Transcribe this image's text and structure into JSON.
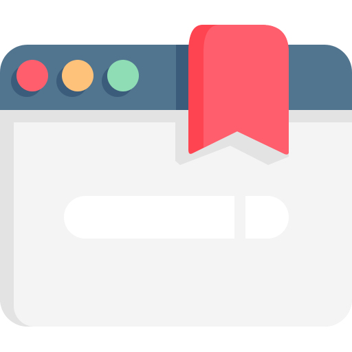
{
  "icon": {
    "name": "bookmark-browser-window-icon",
    "parts": {
      "window": "browser-window",
      "controls": [
        "close-dot",
        "minimize-dot",
        "maximize-dot"
      ],
      "bookmark": "bookmark-ribbon-icon",
      "search": "search-bar"
    }
  },
  "colors": {
    "titlebar": "#52758F",
    "titlebar_shade": "#3B5C7A",
    "window_body": "#F4F4F4",
    "window_shade": "#E3E3E3",
    "dot_red": "#FF5F6D",
    "dot_orange": "#FFC27A",
    "dot_green": "#8EDDB5",
    "dot_shadow": "#3B5C7A",
    "bookmark": "#FF5F6D",
    "bookmark_shade": "#FF4451",
    "search_bar": "#FFFFFF"
  }
}
